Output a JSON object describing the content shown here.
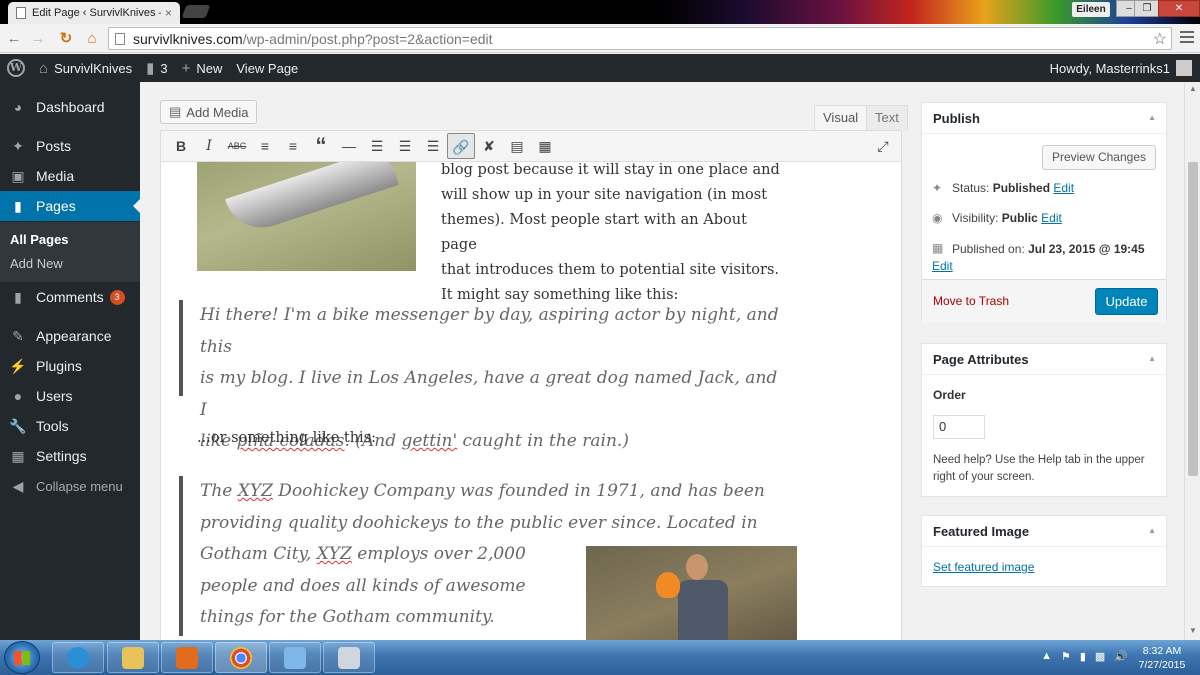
{
  "browser": {
    "tab_title": "Edit Page ‹ SurvivlKnives —",
    "tab_close": "×",
    "profile": "Eileen",
    "url_host": "survivlknives.com",
    "url_path": "/wp-admin/post.php?post=2&action=edit",
    "win_min": "–",
    "win_max": "❐",
    "win_close": "✕"
  },
  "admin_bar": {
    "site_name": "SurvivlKnives",
    "comments_count": "3",
    "new_label": "New",
    "view_page_label": "View Page",
    "howdy": "Howdy, Masterrinks1"
  },
  "sidebar": {
    "items": [
      {
        "label": "Dashboard",
        "icon": "dashboard-icon"
      },
      {
        "label": "Posts",
        "icon": "pin-icon"
      },
      {
        "label": "Media",
        "icon": "media-icon"
      },
      {
        "label": "Pages",
        "icon": "pages-icon"
      },
      {
        "label": "Comments",
        "icon": "comment-icon",
        "badge": "3"
      },
      {
        "label": "Appearance",
        "icon": "paintbrush-icon"
      },
      {
        "label": "Plugins",
        "icon": "plugin-icon"
      },
      {
        "label": "Users",
        "icon": "users-icon"
      },
      {
        "label": "Tools",
        "icon": "wrench-icon"
      },
      {
        "label": "Settings",
        "icon": "settings-icon"
      }
    ],
    "submenu": {
      "all_pages": "All Pages",
      "add_new": "Add New"
    },
    "collapse": "Collapse menu"
  },
  "editor": {
    "add_media": "Add Media",
    "tab_visual": "Visual",
    "tab_text": "Text",
    "intro_lines": [
      "blog post because it will stay in one place and",
      "will show up in your site navigation (in most",
      "themes). Most people start with an About page",
      "that introduces them to potential site visitors.",
      "It might say something like this:"
    ],
    "quote1": {
      "line1": "Hi there! I'm a bike messenger by day, aspiring actor by night, and this",
      "line2": "is my blog. I live in Los Angeles, have a great dog named Jack, and I",
      "line3_pre": "like ",
      "line3_spell": "piña coladas",
      "line3_post": ". (And ",
      "line3_spell2": "gettin'",
      "line3_end": " caught in the rain.)"
    },
    "between": "...or something like this:",
    "quote2": {
      "l1_pre": "The ",
      "l1_spell": "XYZ",
      "l1_post": " Doohickey Company was founded in 1971, and has been",
      "l2": "providing quality doohickeys to the public ever since. Located in",
      "l3_pre": "Gotham City, ",
      "l3_spell": "XYZ",
      "l3_post": " employs over 2,000",
      "l4": "people and does all kinds of awesome",
      "l5": "things for the Gotham community."
    }
  },
  "publish": {
    "title": "Publish",
    "preview": "Preview Changes",
    "status_label": "Status: ",
    "status_value": "Published",
    "visibility_label": "Visibility: ",
    "visibility_value": "Public",
    "published_label": "Published on: ",
    "published_value": "Jul 23, 2015 @ 19:45",
    "edit": "Edit",
    "trash": "Move to Trash",
    "update": "Update"
  },
  "attributes": {
    "title": "Page Attributes",
    "order_label": "Order",
    "order_value": "0",
    "help": "Need help? Use the Help tab in the upper right of your screen."
  },
  "featured": {
    "title": "Featured Image",
    "link": "Set featured image"
  },
  "taskbar": {
    "time": "8:32 AM",
    "date": "7/27/2015"
  }
}
